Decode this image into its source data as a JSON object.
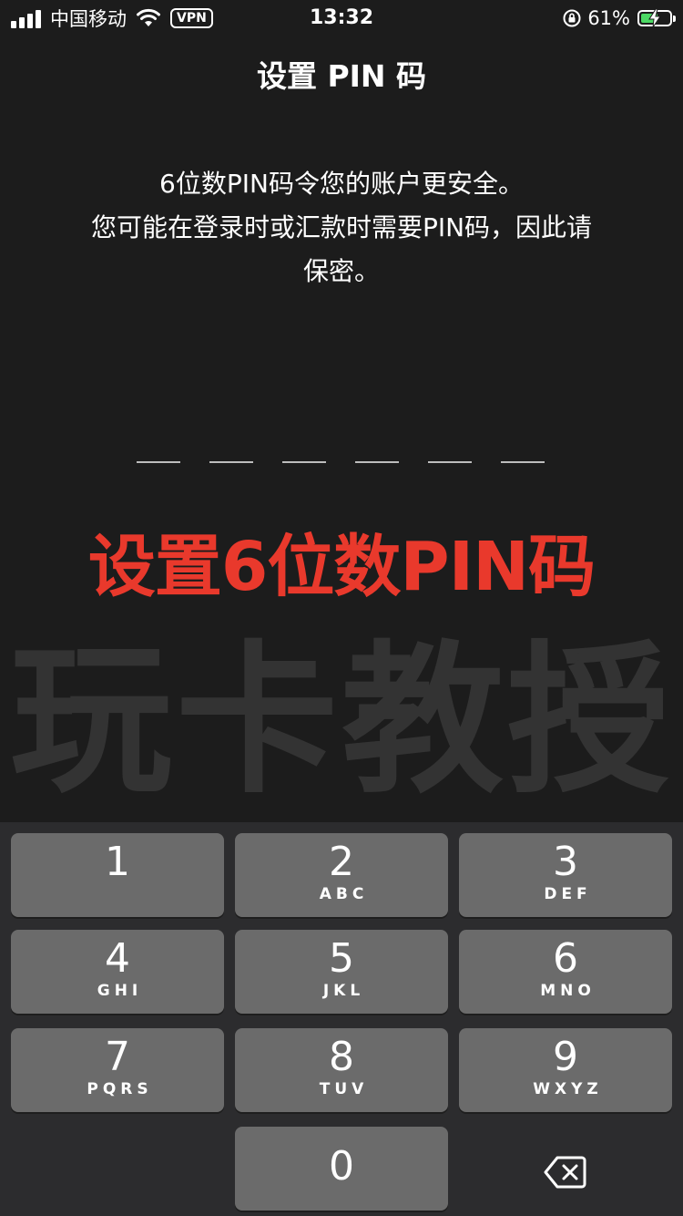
{
  "status_bar": {
    "carrier": "中国移动",
    "vpn": "VPN",
    "time": "13:32",
    "battery_percent": "61%",
    "battery_level": 0.61,
    "battery_color": "#4cd964"
  },
  "header": {
    "title": "设置 PIN 码"
  },
  "description": {
    "line1": "6位数PIN码令您的账户更安全。",
    "line2": "您可能在登录时或汇款时需要PIN码，因此请",
    "line3": "保密。"
  },
  "pin": {
    "length": 6,
    "entered": 0
  },
  "annotation": {
    "text": "设置6位数PIN码",
    "color": "#e9392c"
  },
  "watermark": {
    "text": "玩卡教授"
  },
  "keypad": {
    "keys": [
      {
        "digit": "1",
        "letters": ""
      },
      {
        "digit": "2",
        "letters": "ABC"
      },
      {
        "digit": "3",
        "letters": "DEF"
      },
      {
        "digit": "4",
        "letters": "GHI"
      },
      {
        "digit": "5",
        "letters": "JKL"
      },
      {
        "digit": "6",
        "letters": "MNO"
      },
      {
        "digit": "7",
        "letters": "PQRS"
      },
      {
        "digit": "8",
        "letters": "TUV"
      },
      {
        "digit": "9",
        "letters": "WXYZ"
      },
      {
        "digit": "0",
        "letters": ""
      }
    ],
    "delete_icon": "backspace-icon"
  }
}
